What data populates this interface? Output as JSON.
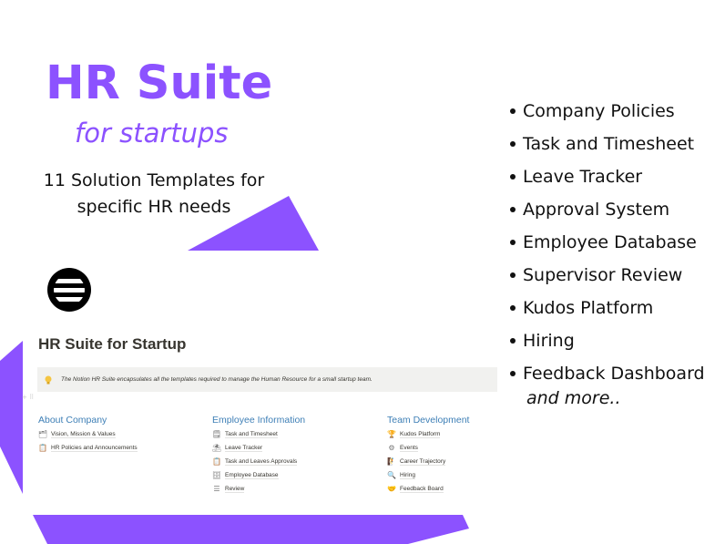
{
  "colors": {
    "accent": "#8c52ff",
    "text_dark": "#111111",
    "notion_heading_blue": "#3e7fb6",
    "callout_bg": "#f1f1ef",
    "notion_text": "#37352f"
  },
  "hero": {
    "title": "HR Suite",
    "subtitle": "for startups",
    "description": "11 Solution Templates for specific HR needs"
  },
  "logo": {
    "icon": "striped-globe-logo"
  },
  "notion_preview": {
    "page_title": "HR Suite for Startup",
    "callout": {
      "icon": "lightbulb-icon",
      "text": "The Notion HR Suite encapsulates all the templates required to manage the Human Resource for a small startup team."
    },
    "drag_handle": "+ ⠿",
    "columns": [
      {
        "heading": "About Company",
        "items": [
          {
            "icon": "document-stack-icon",
            "glyph": "🗂",
            "label": "Vision, Mission & Values"
          },
          {
            "icon": "clipboard-document-icon",
            "glyph": "📋",
            "label": "HR Policies and Announcements"
          }
        ]
      },
      {
        "heading": "Employee Information",
        "items": [
          {
            "icon": "list-document-icon",
            "glyph": "🗒",
            "label": "Task and Timesheet"
          },
          {
            "icon": "sun-umbrella-icon",
            "glyph": "⛱",
            "label": "Leave Tracker"
          },
          {
            "icon": "clipboard-check-icon",
            "glyph": "📋",
            "label": "Task and Leaves Approvals"
          },
          {
            "icon": "database-icon",
            "glyph": "🗄",
            "label": "Employee Database"
          },
          {
            "icon": "checklist-icon",
            "glyph": "☰",
            "label": "Review"
          }
        ]
      },
      {
        "heading": "Team Development",
        "items": [
          {
            "icon": "trophy-icon",
            "glyph": "🏆",
            "label": "Kudos Platform"
          },
          {
            "icon": "calendar-gear-icon",
            "glyph": "⚙",
            "label": "Events"
          },
          {
            "icon": "climbing-person-icon",
            "glyph": "🧗",
            "label": "Career Trajectory"
          },
          {
            "icon": "magnifier-icon",
            "glyph": "🔍",
            "label": "Hiring"
          },
          {
            "icon": "handshake-icon",
            "glyph": "🤝",
            "label": "Feedback Board"
          }
        ]
      }
    ]
  },
  "features": {
    "items": [
      "Company Policies",
      "Task and Timesheet",
      "Leave Tracker",
      "Approval System",
      "Employee Database",
      "Supervisor Review",
      "Kudos Platform",
      "Hiring",
      "Feedback Dashboard"
    ],
    "more_text": "and more.."
  }
}
